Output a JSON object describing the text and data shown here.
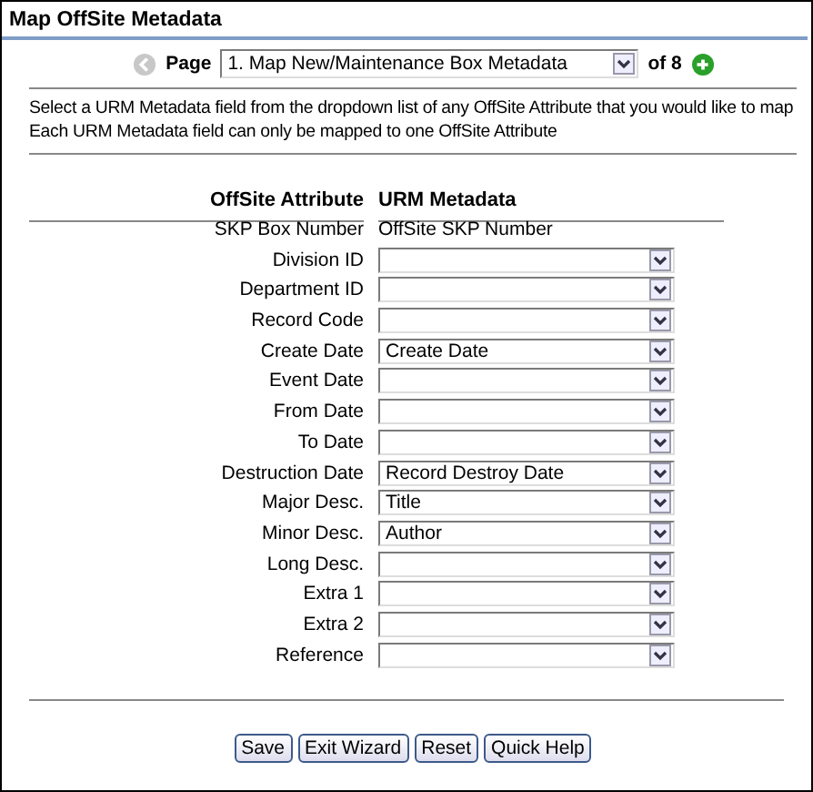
{
  "window": {
    "title": "Map OffSite Metadata"
  },
  "pager": {
    "prev_disabled": true,
    "label": "Page",
    "value": "1.  Map New/Maintenance Box Metadata",
    "of": "of 8",
    "next_disabled": false
  },
  "instructions": [
    "Select a URM Metadata field from the dropdown list of any OffSite Attribute that you would like to map",
    "Each URM Metadata field can only be mapped to one OffSite Attribute"
  ],
  "table": {
    "columns": [
      "OffSite Attribute",
      "URM Metadata"
    ],
    "rows": [
      {
        "attribute": "SKP Box Number",
        "kind": "text",
        "value": "OffSite SKP Number"
      },
      {
        "attribute": "Division ID",
        "kind": "select",
        "value": ""
      },
      {
        "attribute": "Department ID",
        "kind": "select",
        "value": ""
      },
      {
        "attribute": "Record Code",
        "kind": "select",
        "value": ""
      },
      {
        "attribute": "Create Date",
        "kind": "select",
        "value": "Create Date"
      },
      {
        "attribute": "Event Date",
        "kind": "select",
        "value": ""
      },
      {
        "attribute": "From Date",
        "kind": "select",
        "value": ""
      },
      {
        "attribute": "To Date",
        "kind": "select",
        "value": ""
      },
      {
        "attribute": "Destruction Date",
        "kind": "select",
        "value": "Record Destroy Date"
      },
      {
        "attribute": "Major Desc.",
        "kind": "select",
        "value": "Title"
      },
      {
        "attribute": "Minor Desc.",
        "kind": "select",
        "value": "Author"
      },
      {
        "attribute": "Long Desc.",
        "kind": "select",
        "value": ""
      },
      {
        "attribute": "Extra 1",
        "kind": "select",
        "value": ""
      },
      {
        "attribute": "Extra 2",
        "kind": "select",
        "value": ""
      },
      {
        "attribute": "Reference",
        "kind": "select",
        "value": ""
      }
    ]
  },
  "buttons": [
    "Save",
    "Exit Wizard",
    "Reset",
    "Quick Help"
  ]
}
